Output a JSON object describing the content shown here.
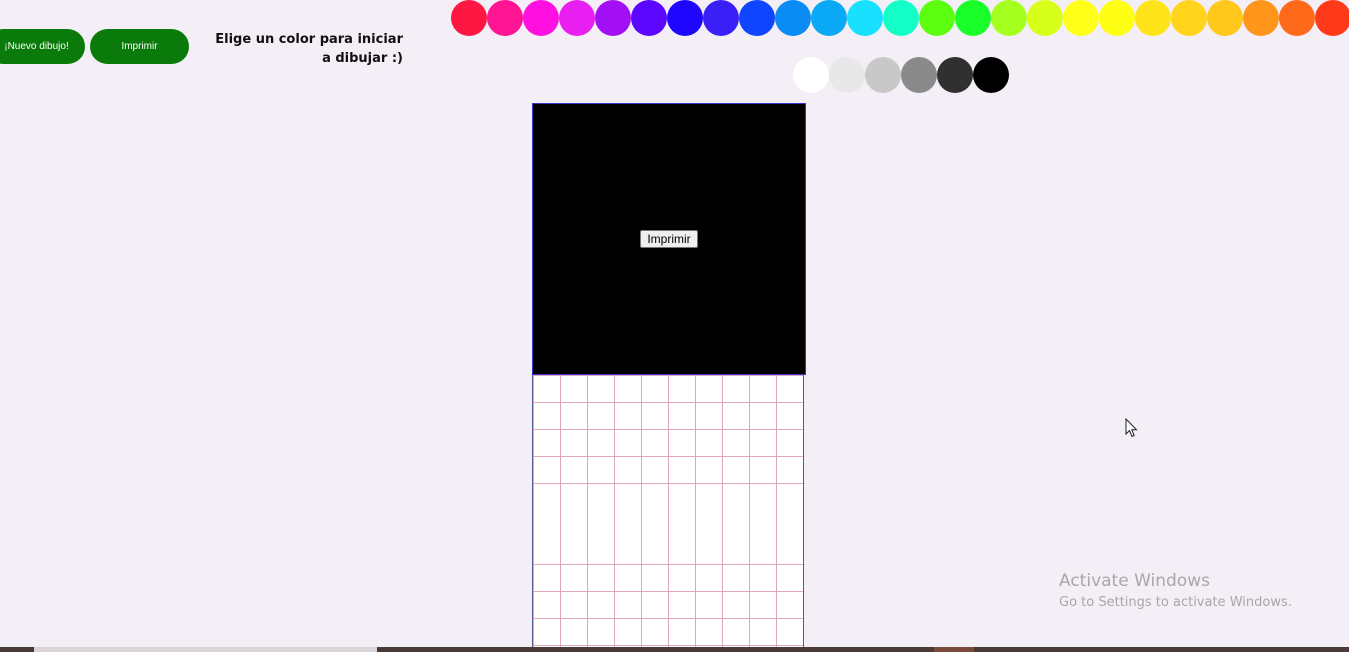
{
  "toolbar": {
    "new_drawing_label": "¡Nuevo dibujo!",
    "print_label": "Imprimir",
    "instruction_text": "Elige un color para iniciar a dibujar :)"
  },
  "palette": {
    "colors": [
      "#ff1744",
      "#ff1493",
      "#ff10e0",
      "#e91ef0",
      "#a20ff5",
      "#5a06ff",
      "#1f06ff",
      "#3a1ff7",
      "#0f45ff",
      "#0b8cf5",
      "#0aa8f5",
      "#1ae0ff",
      "#14ffc8",
      "#5cff10",
      "#1aff2a",
      "#a5ff1f",
      "#d8ff1a",
      "#ffff1a",
      "#ffff14",
      "#ffe41a",
      "#ffd41a",
      "#ffc81a",
      "#ff951a",
      "#ff6a1a",
      "#ff3a1a"
    ],
    "grays": [
      "#ffffff",
      "#e8e8e8",
      "#c8c8c8",
      "#8a8a8a",
      "#303030",
      "#000000"
    ]
  },
  "canvas": {
    "preview_print_label": "Imprimir",
    "preview_background": "#000000",
    "grid_line_color": "#e0a8b8"
  },
  "watermark": {
    "title": "Activate Windows",
    "subtitle": "Go to Settings to activate Windows."
  }
}
